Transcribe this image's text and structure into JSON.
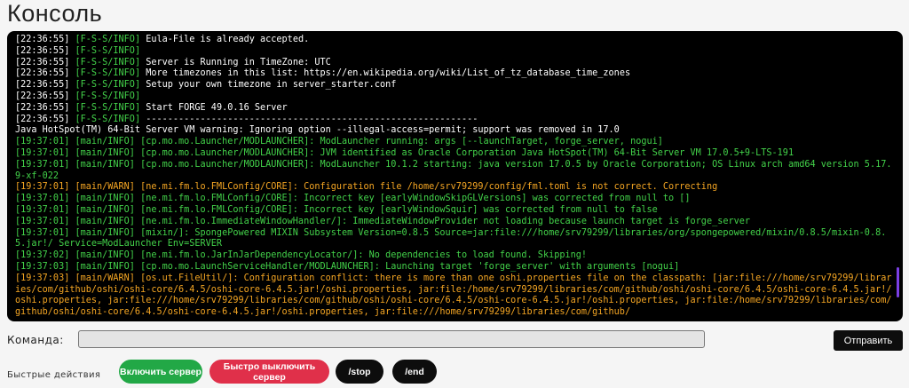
{
  "page": {
    "title": "Консоль"
  },
  "console": {
    "lines": [
      {
        "color": "w",
        "ts": "[22:36:55]",
        "tag": " [F-S-S/INFO]",
        "msg": " Eula-File is already accepted."
      },
      {
        "color": "w",
        "ts": "[22:36:55]",
        "tag": " [F-S-S/INFO]",
        "msg": ""
      },
      {
        "color": "w",
        "ts": "[22:36:55]",
        "tag": " [F-S-S/INFO]",
        "msg": " Server is Running in TimeZone: UTC"
      },
      {
        "color": "w",
        "ts": "[22:36:55]",
        "tag": " [F-S-S/INFO]",
        "msg": " More timezones in this list: https://en.wikipedia.org/wiki/List_of_tz_database_time_zones"
      },
      {
        "color": "w",
        "ts": "[22:36:55]",
        "tag": " [F-S-S/INFO]",
        "msg": " Setup your own timezone in server_starter.conf"
      },
      {
        "color": "w",
        "ts": "[22:36:55]",
        "tag": " [F-S-S/INFO]",
        "msg": ""
      },
      {
        "color": "w",
        "ts": "[22:36:55]",
        "tag": " [F-S-S/INFO]",
        "msg": " Start FORGE 49.0.16 Server"
      },
      {
        "color": "w",
        "ts": "[22:36:55]",
        "tag": " [F-S-S/INFO]",
        "msg": " -------------------------------------------------------------"
      },
      {
        "color": "w",
        "ts": "",
        "tag": "",
        "msg": "Java HotSpot(TM) 64-Bit Server VM warning: Ignoring option --illegal-access=permit; support was removed in 17.0"
      },
      {
        "color": "g",
        "ts": "",
        "tag": "",
        "msg": "[19:37:01] [main/INFO] [cp.mo.mo.Launcher/MODLAUNCHER]: ModLauncher running: args [--launchTarget, forge_server, nogui]"
      },
      {
        "color": "g",
        "ts": "",
        "tag": "",
        "msg": "[19:37:01] [main/INFO] [cp.mo.mo.Launcher/MODLAUNCHER]: JVM identified as Oracle Corporation Java HotSpot(TM) 64-Bit Server VM 17.0.5+9-LTS-191"
      },
      {
        "color": "g",
        "ts": "",
        "tag": "",
        "msg": "[19:37:01] [main/INFO] [cp.mo.mo.Launcher/MODLAUNCHER]: ModLauncher 10.1.2 starting: java version 17.0.5 by Oracle Corporation; OS Linux arch amd64 version 5.17.9-xf-022"
      },
      {
        "color": "o",
        "ts": "",
        "tag": "",
        "msg": "[19:37:01] [main/WARN] [ne.mi.fm.lo.FMLConfig/CORE]: Configuration file /home/srv79299/config/fml.toml is not correct. Correcting"
      },
      {
        "color": "g",
        "ts": "",
        "tag": "",
        "msg": "[19:37:01] [main/INFO] [ne.mi.fm.lo.FMLConfig/CORE]: Incorrect key [earlyWindowSkipGLVersions] was corrected from null to []"
      },
      {
        "color": "g",
        "ts": "",
        "tag": "",
        "msg": "[19:37:01] [main/INFO] [ne.mi.fm.lo.FMLConfig/CORE]: Incorrect key [earlyWindowSquir] was corrected from null to false"
      },
      {
        "color": "g",
        "ts": "",
        "tag": "",
        "msg": "[19:37:01] [main/INFO] [ne.mi.fm.lo.ImmediateWindowHandler/]: ImmediateWindowProvider not loading because launch target is forge_server"
      },
      {
        "color": "g",
        "ts": "",
        "tag": "",
        "msg": "[19:37:01] [main/INFO] [mixin/]: SpongePowered MIXIN Subsystem Version=0.8.5 Source=jar:file:///home/srv79299/libraries/org/spongepowered/mixin/0.8.5/mixin-0.8.5.jar!/ Service=ModLauncher Env=SERVER"
      },
      {
        "color": "g",
        "ts": "",
        "tag": "",
        "msg": "[19:37:02] [main/INFO] [ne.mi.fm.lo.JarInJarDependencyLocator/]: No dependencies to load found. Skipping!"
      },
      {
        "color": "g",
        "ts": "",
        "tag": "",
        "msg": "[19:37:03] [main/INFO] [cp.mo.mo.LaunchServiceHandler/MODLAUNCHER]: Launching target 'forge_server' with arguments [nogui]"
      },
      {
        "color": "o",
        "ts": "",
        "tag": "",
        "msg": "[19:37:03] [main/WARN] [os.ut.FileUtil/]: Configuration conflict: there is more than one oshi.properties file on the classpath: [jar:file:///home/srv79299/libraries/com/github/oshi/oshi-core/6.4.5/oshi-core-6.4.5.jar!/oshi.properties, jar:file:/home/srv79299/libraries/com/github/oshi/oshi-core/6.4.5/oshi-core-6.4.5.jar!/oshi.properties, jar:file:///home/srv79299/libraries/com/github/oshi/oshi-core/6.4.5/oshi-core-6.4.5.jar!/oshi.properties, jar:file:/home/srv79299/libraries/com/github/oshi/oshi-core/6.4.5/oshi-core-6.4.5.jar!/oshi.properties, jar:file:///home/srv79299/libraries/com/github/"
      }
    ],
    "colors": {
      "white": "#ffffff",
      "green": "#43d34a",
      "orange": "#f5a623",
      "scrollbar": "#7b3fe4"
    }
  },
  "command": {
    "label": "Команда:",
    "value": "",
    "placeholder": "",
    "send_label": "Отправить"
  },
  "quick_actions": {
    "label": "Быстрые действия",
    "buttons": [
      {
        "label": "Включить сервер",
        "color": "#22a846"
      },
      {
        "label": "Быстро выключить сервер",
        "color": "#e0304a"
      },
      {
        "label": "/stop",
        "color": "#0d0d0d"
      },
      {
        "label": "/end",
        "color": "#0d0d0d"
      }
    ]
  }
}
